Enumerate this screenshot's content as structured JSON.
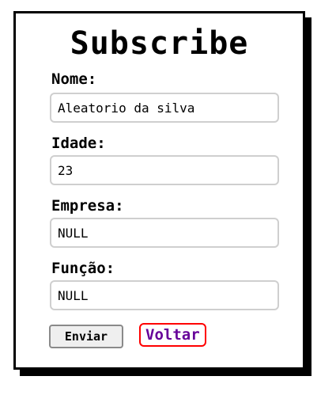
{
  "form": {
    "title": "Subscribe",
    "fields": [
      {
        "label": "Nome:",
        "value": "Aleatorio da silva"
      },
      {
        "label": "Idade:",
        "value": "23"
      },
      {
        "label": "Empresa:",
        "value": "NULL"
      },
      {
        "label": "Função:",
        "value": "NULL"
      }
    ],
    "submit_label": "Enviar",
    "back_link_label": "Voltar"
  },
  "colors": {
    "border": "#000000",
    "input_border": "#cfcfcf",
    "link_text": "#660099",
    "link_focus_outline": "#ff0000",
    "button_bg": "#efefef"
  }
}
